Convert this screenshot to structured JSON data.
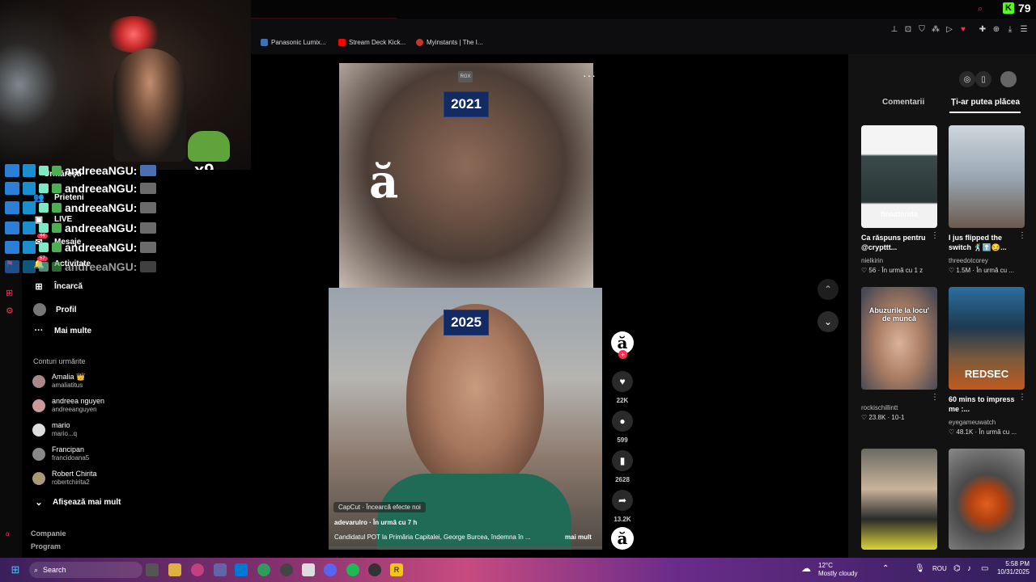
{
  "browser": {
    "kick_count": "79",
    "bookmarks": [
      "Panasonic Lumix...",
      "Stream Deck Kick...",
      "Myinstants | The I..."
    ]
  },
  "overlay": {
    "multiplier": "x9",
    "chat_name": "andreeaNGU:"
  },
  "sidebar": {
    "nav": [
      {
        "label": "Urmărești",
        "icon": "following-icon"
      },
      {
        "label": "Prieteni",
        "icon": "friends-icon"
      },
      {
        "label": "LIVE",
        "icon": "live-icon"
      },
      {
        "label": "Mesaje",
        "icon": "messages-icon",
        "badge": "44"
      },
      {
        "label": "Activitate",
        "icon": "activity-icon",
        "badge": "57"
      },
      {
        "label": "Încarcă",
        "icon": "upload-icon"
      },
      {
        "label": "Profil",
        "icon": "profile-icon"
      },
      {
        "label": "Mai multe",
        "icon": "more-icon"
      }
    ],
    "following_title": "Conturi urmărite",
    "following": [
      {
        "name": "Amalia 👑",
        "handle": "amaliatitus"
      },
      {
        "name": "andreea nguyen",
        "handle": "andreeanguyen"
      },
      {
        "name": "mario",
        "handle": "mario...q"
      },
      {
        "name": "Francipan",
        "handle": "francidoana5"
      },
      {
        "name": "Robert Chirita",
        "handle": "robertchirita2"
      }
    ],
    "show_more": "Afișează mai mult",
    "footer": [
      "Companie",
      "Program"
    ]
  },
  "video": {
    "badge_top": "2021",
    "badge_bottom": "2025",
    "rgx": "RGX",
    "capcut": "CapCut · Încearcă efecte noi",
    "author_line": "adevarulro · În urmă cu 7 h",
    "caption": "Candidatul POT la Primăria Capitalei, George Burcea, îndemna în ...",
    "more": "mai mult",
    "likes": "22K",
    "comments": "599",
    "saves": "2628",
    "shares": "13.2K"
  },
  "right_panel": {
    "tabs": [
      "Comentarii",
      "Ți-ar putea plăcea"
    ],
    "active_tab": 1,
    "recommendations": [
      {
        "overlay": "finasterida",
        "title": "Ca răspuns pentru @crypttt...",
        "user": "nielkirin",
        "likes": "56",
        "time": "În urmă cu 1 z"
      },
      {
        "overlay": "",
        "title": "I jus flipped the switch 🕺⬆️😏...",
        "user": "threedotcorey",
        "likes": "1.5M",
        "time": "În urmă cu ..."
      },
      {
        "overlay": "Abuzurile la locu' de muncă",
        "title": "",
        "user": "rockischillintt",
        "likes": "23.8K",
        "time": "10-1"
      },
      {
        "overlay": "REDSEC",
        "title": "60 mins to impress me :...",
        "user": "eyegameuwatch",
        "likes": "48.1K",
        "time": "În urmă cu ..."
      }
    ]
  },
  "taskbar": {
    "search": "Search",
    "weather_temp": "12°C",
    "weather_desc": "Mostly cloudy",
    "lang": "ROU",
    "time": "5:58 PM",
    "date": "10/31/2025"
  }
}
